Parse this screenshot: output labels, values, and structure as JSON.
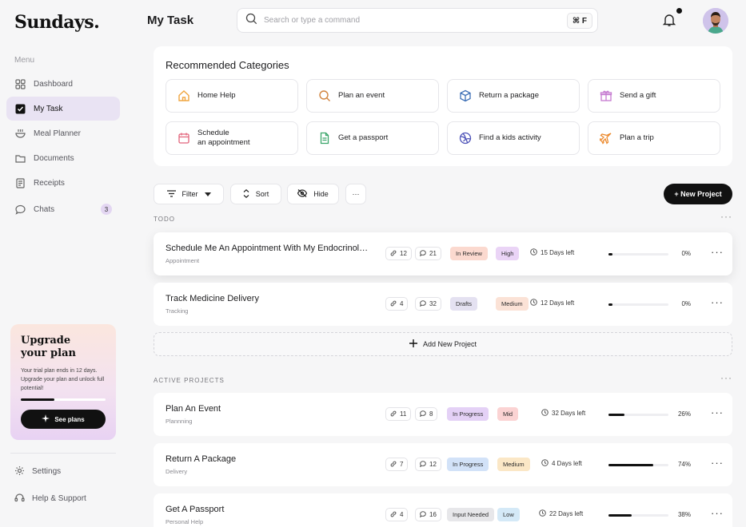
{
  "brand": "Sundays.",
  "menu_label": "Menu",
  "nav": [
    {
      "label": "Dashboard",
      "icon": "grid-icon"
    },
    {
      "label": "My Task",
      "icon": "checkbox-icon",
      "active": true
    },
    {
      "label": "Meal Planner",
      "icon": "bowl-icon"
    },
    {
      "label": "Documents",
      "icon": "folder-icon"
    },
    {
      "label": "Receipts",
      "icon": "receipt-icon"
    },
    {
      "label": "Chats",
      "icon": "chat-icon",
      "badge": "3"
    }
  ],
  "upgrade": {
    "title": "Upgrade your plan",
    "text": "Your trial plan ends in 12 days. Upgrade your plan and unlock full potential!",
    "progress": 0.4,
    "button": "See plans"
  },
  "bottom_nav": [
    {
      "label": "Settings",
      "icon": "gear-icon"
    },
    {
      "label": "Help & Support",
      "icon": "headset-icon"
    }
  ],
  "page_title": "My Task",
  "search": {
    "placeholder": "Search or type a command",
    "shortcut": "⌘ F"
  },
  "recommended": {
    "title": "Recommended Categories",
    "items": [
      {
        "label": "Home Help",
        "icon": "home-icon",
        "color": "#f0a640"
      },
      {
        "label": "Plan an event",
        "icon": "search-icon",
        "color": "#d2843f"
      },
      {
        "label": "Return a package",
        "icon": "box-icon",
        "color": "#3d6fb6"
      },
      {
        "label": "Send a gift",
        "icon": "gift-icon",
        "color": "#c57ad0"
      },
      {
        "label": "Schedule\nan appointment",
        "icon": "calendar-icon",
        "color": "#e2657c"
      },
      {
        "label": "Get a passport",
        "icon": "document-icon",
        "color": "#3aa56a"
      },
      {
        "label": "Find a kids activity",
        "icon": "ball-icon",
        "color": "#4d52b8"
      },
      {
        "label": "Plan a trip",
        "icon": "plane-icon",
        "color": "#ec8a2e"
      }
    ]
  },
  "toolbar": {
    "filter": "Filter",
    "sort": "Sort",
    "hide": "Hide",
    "more": "···",
    "new_project": "+ New Project"
  },
  "todo": {
    "label": "TODO",
    "rows": [
      {
        "name": "Schedule Me An Appointment With My Endocrinologist",
        "category": "Appointment",
        "links": "12",
        "comments": "21",
        "status": "In Review",
        "status_color": "#fbd9cf",
        "priority": "High",
        "priority_color": "#ead4f6",
        "due": "15 Days left",
        "progress": 0.0,
        "pct": "0%"
      },
      {
        "name": "Track Medicine Delivery",
        "category": "Tracking",
        "links": "4",
        "comments": "32",
        "status": "Drafts",
        "status_color": "#e4e1f1",
        "priority": "Medium",
        "priority_color": "#fbe2d6",
        "due": "12 Days left",
        "progress": 0.0,
        "pct": "0%"
      }
    ],
    "add": "Add New Project"
  },
  "active": {
    "label": "ACTIVE PROJECTS",
    "rows": [
      {
        "name": "Plan An Event",
        "category": "Plannning",
        "links": "11",
        "comments": "8",
        "status": "In Progress",
        "status_color": "#e4d1f6",
        "priority": "Mid",
        "priority_color": "#fbd3d3",
        "due": "32 Days left",
        "progress": 0.26,
        "pct": "26%"
      },
      {
        "name": "Return A Package",
        "category": "Delivery",
        "links": "7",
        "comments": "12",
        "status": "In Progress",
        "status_color": "#d2e2f8",
        "priority": "Medium",
        "priority_color": "#fbe7c6",
        "due": "4 Days left",
        "progress": 0.74,
        "pct": "74%"
      },
      {
        "name": "Get A Passport",
        "category": "Personal Help",
        "links": "4",
        "comments": "16",
        "status": "Input Needed",
        "status_color": "#e7e7ea",
        "priority": "Low",
        "priority_color": "#d4e9f7",
        "due": "22 Days left",
        "progress": 0.38,
        "pct": "38%"
      }
    ]
  }
}
